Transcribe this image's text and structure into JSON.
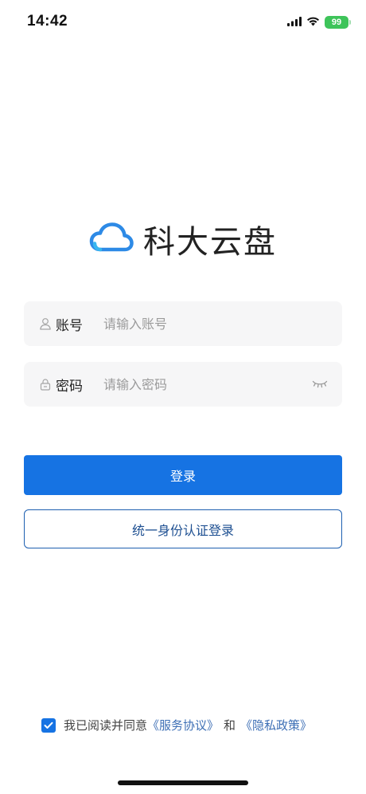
{
  "status_bar": {
    "time": "14:42",
    "battery": "99"
  },
  "app": {
    "name": "科大云盘",
    "brand_color": "#2d8ae6"
  },
  "form": {
    "account": {
      "label": "账号",
      "placeholder": "请输入账号",
      "value": ""
    },
    "password": {
      "label": "密码",
      "placeholder": "请输入密码",
      "value": ""
    }
  },
  "buttons": {
    "login": "登录",
    "sso_login": "统一身份认证登录"
  },
  "agreement": {
    "checked": true,
    "prefix": "我已阅读并同意",
    "service_link": "《服务协议》",
    "and": "和",
    "privacy_link": "《隐私政策》"
  },
  "colors": {
    "primary": "#1673e3",
    "link": "#3d6fb5",
    "input_bg": "#f6f6f7",
    "battery": "#3ec45a"
  },
  "icons": {
    "logo": "cloud-icon",
    "account": "user-icon",
    "password": "lock-icon",
    "toggle": "eye-closed-icon",
    "checkbox": "checkmark-icon"
  }
}
